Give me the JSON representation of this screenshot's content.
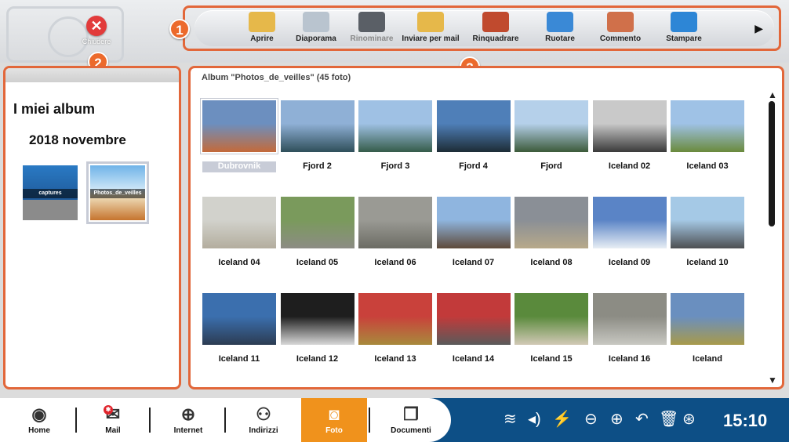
{
  "window": {
    "close_label": "Chiudere"
  },
  "toolbar": {
    "tools": [
      {
        "label": "Aprire",
        "icon": "folder-icon",
        "color": "#e6b84a"
      },
      {
        "label": "Diaporama",
        "icon": "slideshow-icon",
        "color": "#b9c4cf"
      },
      {
        "label": "Rinominare",
        "icon": "rename-icon",
        "color": "#5a5f66"
      },
      {
        "label": "Inviare per mail",
        "icon": "mail-folder-icon",
        "color": "#e6b84a"
      },
      {
        "label": "Rinquadrare",
        "icon": "crop-icon",
        "color": "#c04a2e"
      },
      {
        "label": "Ruotare",
        "icon": "rotate-icon",
        "color": "#3a89d6"
      },
      {
        "label": "Commento",
        "icon": "comment-icon",
        "color": "#d0704a"
      },
      {
        "label": "Stampare",
        "icon": "printer-icon",
        "color": "#2d86d6"
      }
    ]
  },
  "badges": [
    "1",
    "2",
    "3"
  ],
  "left": {
    "title": "I miei album",
    "group": "2018 novembre",
    "albums": [
      "captures",
      "Photos_de_veilles"
    ]
  },
  "main": {
    "album_title": "Album \"Photos_de_veilles\" (45 foto)",
    "photos": [
      {
        "name": "Dubrovnik",
        "colors": [
          "#6c8fbf",
          "#c46a3a"
        ]
      },
      {
        "name": "Fjord 2",
        "colors": [
          "#8fb0d6",
          "#2f4f5a"
        ]
      },
      {
        "name": "Fjord 3",
        "colors": [
          "#9fc1e4",
          "#355c4a"
        ]
      },
      {
        "name": "Fjord 4",
        "colors": [
          "#4f7fb8",
          "#1d2c36"
        ]
      },
      {
        "name": "Fjord",
        "colors": [
          "#b5d0ea",
          "#3c5a3a"
        ]
      },
      {
        "name": "Iceland 02",
        "colors": [
          "#c9c9c9",
          "#3a3a3a"
        ]
      },
      {
        "name": "Iceland 03",
        "colors": [
          "#9fc2e6",
          "#6a8a3c"
        ]
      },
      {
        "name": "Iceland 04",
        "colors": [
          "#d2d2cc",
          "#b3ad9e"
        ]
      },
      {
        "name": "Iceland 05",
        "colors": [
          "#7a9a5c",
          "#8c8c84"
        ]
      },
      {
        "name": "Iceland 06",
        "colors": [
          "#9a9a94",
          "#6c6c64"
        ]
      },
      {
        "name": "Iceland 07",
        "colors": [
          "#8fb5df",
          "#5e4a3a"
        ]
      },
      {
        "name": "Iceland 08",
        "colors": [
          "#8a8f96",
          "#b7a98a"
        ]
      },
      {
        "name": "Iceland 09",
        "colors": [
          "#5a84c6",
          "#e8eef4"
        ]
      },
      {
        "name": "Iceland 10",
        "colors": [
          "#a5c9e6",
          "#4d4f52"
        ]
      },
      {
        "name": "Iceland 11",
        "colors": [
          "#3b6fae",
          "#2c3c52"
        ]
      },
      {
        "name": "Iceland 12",
        "colors": [
          "#1e1e1e",
          "#d8d8d8"
        ]
      },
      {
        "name": "Iceland 13",
        "colors": [
          "#c9413b",
          "#a88a3c"
        ]
      },
      {
        "name": "Iceland 14",
        "colors": [
          "#c23a3a",
          "#5a5a5a"
        ]
      },
      {
        "name": "Iceland 15",
        "colors": [
          "#5a8a3c",
          "#d2c9b6"
        ]
      },
      {
        "name": "Iceland 16",
        "colors": [
          "#8c8c84",
          "#c8c8c2"
        ]
      },
      {
        "name": "Iceland",
        "colors": [
          "#6a8fbf",
          "#a89a4a"
        ]
      }
    ]
  },
  "taskbar": {
    "items": [
      {
        "label": "Home",
        "icon": "home-icon",
        "glyph": "◉"
      },
      {
        "label": "Mail",
        "icon": "mail-icon",
        "glyph": "✉"
      },
      {
        "label": "Internet",
        "icon": "globe-icon",
        "glyph": "⊕"
      },
      {
        "label": "Indirizzi",
        "icon": "contacts-icon",
        "glyph": "⚇"
      },
      {
        "label": "Foto",
        "icon": "camera-icon",
        "glyph": "◙"
      },
      {
        "label": "Documenti",
        "icon": "documents-icon",
        "glyph": "❐"
      }
    ],
    "mail_badge": "✱",
    "tray": [
      {
        "icon": "wifi-icon",
        "glyph": "≋"
      },
      {
        "icon": "volume-icon",
        "glyph": "◂)"
      },
      {
        "icon": "battery-icon",
        "glyph": "⚡"
      },
      {
        "icon": "zoom-out-icon",
        "glyph": "⊖"
      },
      {
        "icon": "zoom-in-icon",
        "glyph": "⊕"
      },
      {
        "icon": "undo-icon",
        "glyph": "↶"
      },
      {
        "icon": "trash-icon",
        "glyph": "🗑"
      },
      {
        "icon": "help-icon",
        "glyph": "⊛"
      }
    ],
    "time": "15:10"
  }
}
